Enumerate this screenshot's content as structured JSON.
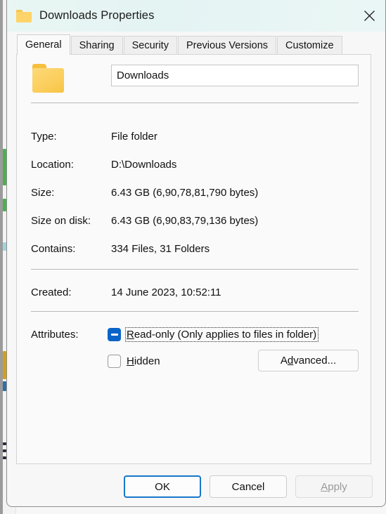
{
  "window": {
    "title": "Downloads Properties",
    "title_icon": "folder-icon",
    "close_icon": "close-icon"
  },
  "tabs": [
    {
      "label": "General",
      "active": true
    },
    {
      "label": "Sharing",
      "active": false
    },
    {
      "label": "Security",
      "active": false
    },
    {
      "label": "Previous Versions",
      "active": false
    },
    {
      "label": "Customize",
      "active": false
    }
  ],
  "general": {
    "folder_icon": "folder-icon",
    "name_value": "Downloads",
    "properties": [
      {
        "label": "Type:",
        "value": "File folder"
      },
      {
        "label": "Location:",
        "value": "D:\\Downloads"
      },
      {
        "label": "Size:",
        "value": "6.43 GB (6,90,78,81,790 bytes)"
      },
      {
        "label": "Size on disk:",
        "value": "6.43 GB (6,90,83,79,136 bytes)"
      },
      {
        "label": "Contains:",
        "value": "334 Files, 31 Folders"
      }
    ],
    "created": {
      "label": "Created:",
      "value": "14 June 2023, 10:52:11"
    },
    "attributes": {
      "label": "Attributes:",
      "readonly": {
        "state": "indeterminate",
        "accel": "R",
        "text_rest": "ead-only (Only applies to files in folder)",
        "focused": true
      },
      "hidden": {
        "state": "unchecked",
        "accel": "H",
        "text_rest": "idden",
        "focused": false
      },
      "advanced_accel": "A",
      "advanced_pre": "A",
      "advanced_mid": "d",
      "advanced_post": "vanced..."
    }
  },
  "footer": {
    "ok_label": "OK",
    "cancel_label": "Cancel",
    "apply_accel": "A",
    "apply_rest": "pply",
    "apply_disabled": true
  },
  "colors": {
    "accent": "#0a64c8",
    "default_button_border": "#1877c8",
    "titlebar": "#e7f5f3",
    "folder_yellow": "#fbce5c"
  }
}
